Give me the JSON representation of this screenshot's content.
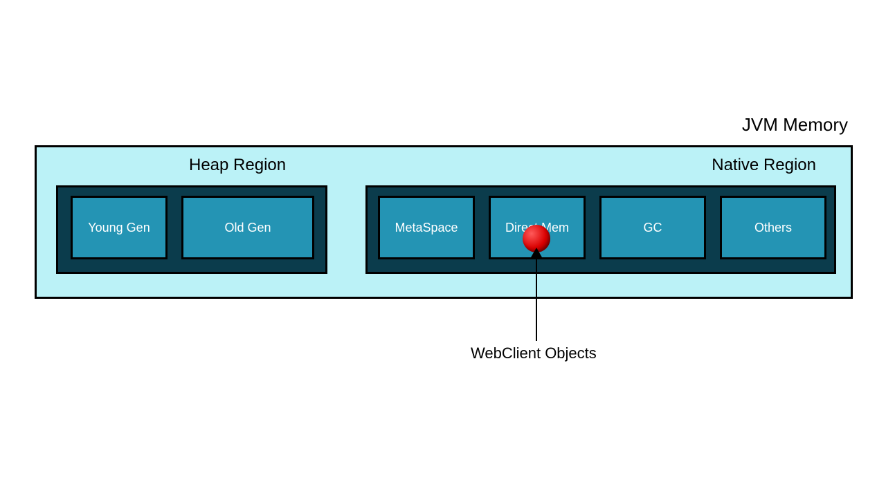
{
  "title": "JVM Memory",
  "regions": {
    "heap": {
      "title": "Heap Region",
      "cells": {
        "young": "Young Gen",
        "old": "Old Gen"
      }
    },
    "native": {
      "title": "Native Region",
      "cells": {
        "meta": "MetaSpace",
        "direct": "Direct Mem",
        "gc": "GC",
        "others": "Others"
      }
    }
  },
  "annotation": {
    "label": "WebClient Objects",
    "points_to": "direct-memory-cell",
    "marker": "red-ball"
  },
  "colors": {
    "outer_bg": "#bbf2f7",
    "panel_bg": "#0b3c4c",
    "cell_bg": "#2494b4",
    "marker": "#d90000",
    "border": "#000000"
  }
}
